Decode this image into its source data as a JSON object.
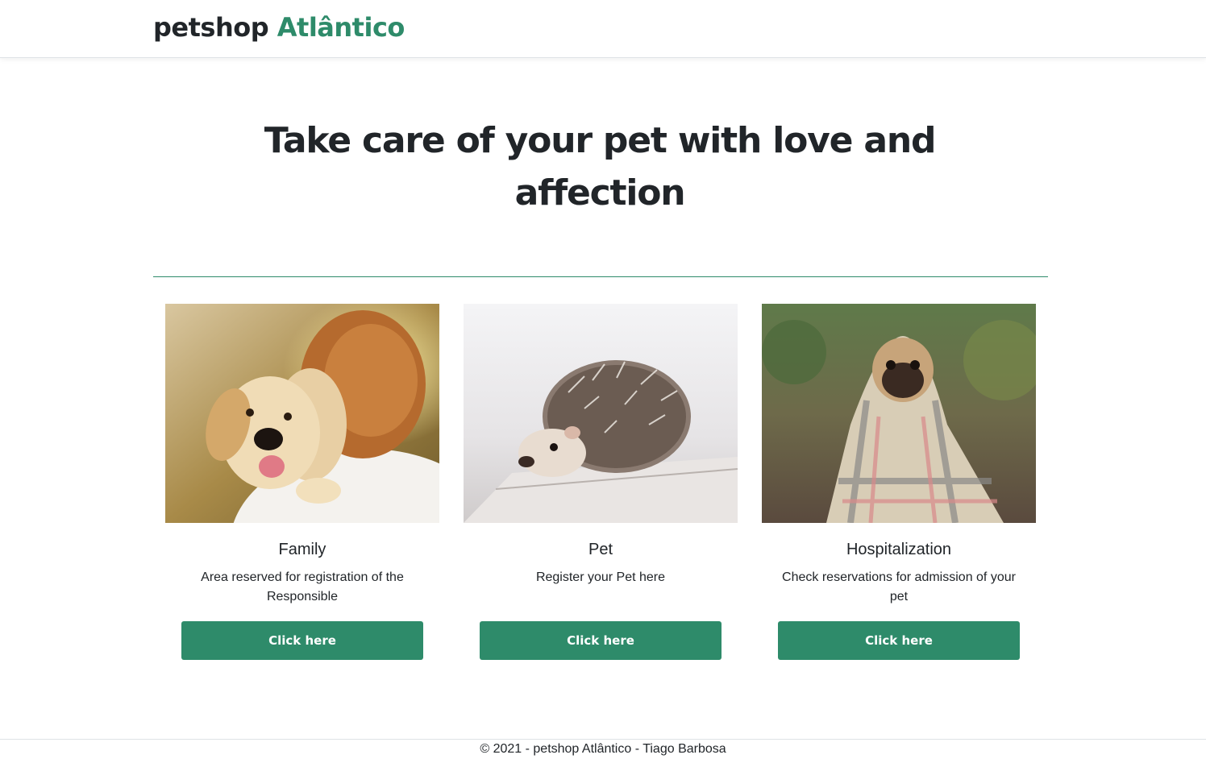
{
  "brand": {
    "name": "petshop",
    "accent": "Atlântico",
    "accent_color": "#2e8b6a"
  },
  "hero": {
    "title": "Take care of your pet with love and affection"
  },
  "cards": [
    {
      "image": "puppy-and-boy-photo",
      "title": "Family",
      "text": "Area reserved for registration of the Responsible",
      "button": "Click here"
    },
    {
      "image": "hedgehog-photo",
      "title": "Pet",
      "text": "Register your Pet here",
      "button": "Click here"
    },
    {
      "image": "pug-in-blanket-photo",
      "title": "Hospitalization",
      "text": "Check reservations for admission of your pet",
      "button": "Click here"
    }
  ],
  "footer": {
    "text": "© 2021 - petshop Atlântico - Tiago Barbosa"
  },
  "colors": {
    "accent": "#2e8b6a",
    "text": "#212529",
    "background": "#ffffff"
  }
}
